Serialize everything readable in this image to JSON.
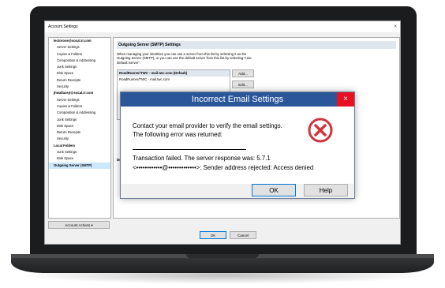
{
  "window": {
    "title": "Account Settings",
    "close_glyph": "×"
  },
  "tree": {
    "items": [
      {
        "label": "lectorone@socal.rr.com",
        "kind": "acc"
      },
      {
        "label": "Server Settings",
        "kind": "sub"
      },
      {
        "label": "Copies & Folders",
        "kind": "sub"
      },
      {
        "label": "Composition & Addressing",
        "kind": "sub"
      },
      {
        "label": "Junk Settings",
        "kind": "sub"
      },
      {
        "label": "Disk Space",
        "kind": "sub"
      },
      {
        "label": "Return Receipts",
        "kind": "sub"
      },
      {
        "label": "Security",
        "kind": "sub"
      },
      {
        "label": "jhwallacejr@socal.rr.com",
        "kind": "acc"
      },
      {
        "label": "Server Settings",
        "kind": "sub"
      },
      {
        "label": "Copies & Folders",
        "kind": "sub"
      },
      {
        "label": "Composition & Addressing",
        "kind": "sub"
      },
      {
        "label": "Junk Settings",
        "kind": "sub"
      },
      {
        "label": "Disk Space",
        "kind": "sub"
      },
      {
        "label": "Return Receipts",
        "kind": "sub"
      },
      {
        "label": "Security",
        "kind": "sub"
      },
      {
        "label": "Local Folders",
        "kind": "acc"
      },
      {
        "label": "Junk Settings",
        "kind": "sub"
      },
      {
        "label": "Disk Space",
        "kind": "sub"
      },
      {
        "label": "Outgoing Server (SMTP)",
        "kind": "acc sel"
      }
    ],
    "account_actions_label": "Account Actions"
  },
  "panel": {
    "heading": "Outgoing Server (SMTP) Settings",
    "description": "When managing your identities you can use a server from this list by selecting it as the Outgoing Server (SMTP), or you can use the default server from this list by selecting \"Use Default Server\".",
    "servers": [
      {
        "label": "RoadRunner/TWC - mail.twc.com (Default)",
        "selected": true
      },
      {
        "label": "RoadRunner/TWC - mail.twc.com",
        "selected": false
      }
    ],
    "add_label": "Add...",
    "edit_label": "Edit...",
    "details_fragment": "Det",
    "au_fragment": "Au"
  },
  "bottom": {
    "ok_label": "OK",
    "cancel_label": "Cancel"
  },
  "dialog": {
    "title": "Incorrect Email Settings",
    "close_glyph": "×",
    "line1": "Contact your email provider to verify the email settings.",
    "line2": "The following error was returned:",
    "line3": "Transaction failed. The server response was: 5.7.1",
    "line4": "<••••••••••••@•••••••••••••>: Sender address rejected: Access denied",
    "ok_label": "OK",
    "help_label": "Help",
    "icon": "error-x-icon",
    "colors": {
      "title_bar": "#2b579a",
      "close": "#e81123",
      "icon": "#d1343b"
    }
  }
}
